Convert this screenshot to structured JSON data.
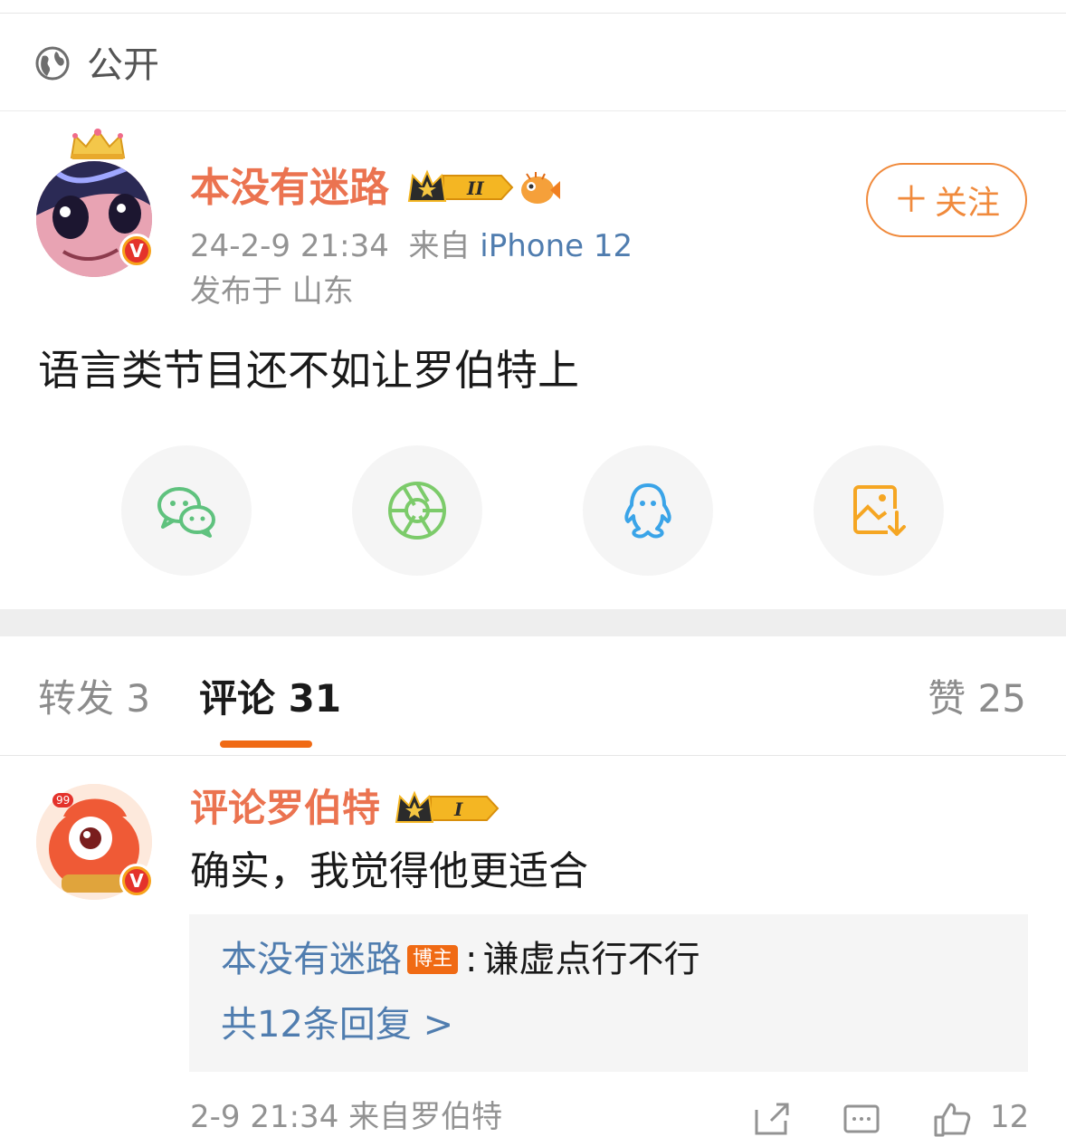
{
  "visibility": {
    "label": "公开",
    "icon": "globe-icon"
  },
  "post": {
    "author": "本没有迷路",
    "level_badge": "II",
    "timestamp": "24-2-9 21:34",
    "source_prefix": "来自",
    "device": "iPhone 12",
    "location": "发布于 山东",
    "text": "语言类节目还不如让罗伯特上",
    "follow_label": "关注",
    "follow_plus": "＋"
  },
  "share": {
    "items": [
      "wechat-icon",
      "moments-icon",
      "qq-icon",
      "save-image-icon"
    ]
  },
  "tabs": {
    "repost": "转发 3",
    "comments": "评论 31",
    "likes": "赞 25"
  },
  "comment": {
    "author": "评论罗伯特",
    "avatar_badge_count": "99",
    "level_badge": "I",
    "text": "确实，我觉得他更适合",
    "reply": {
      "user": "本没有迷路",
      "host_tag": "博主",
      "colon": ":",
      "text": "谦虚点行不行",
      "more": "共12条回复 >"
    },
    "footer_meta": "2-9 21:34 来自罗伯特",
    "like_count": "12"
  },
  "colors": {
    "accent": "#f06a14",
    "username": "#eb7350",
    "link": "#507daf",
    "wechat": "#5fc27e",
    "moments": "#7ccb6a",
    "qq": "#3aa4e8",
    "save": "#f5a623"
  }
}
